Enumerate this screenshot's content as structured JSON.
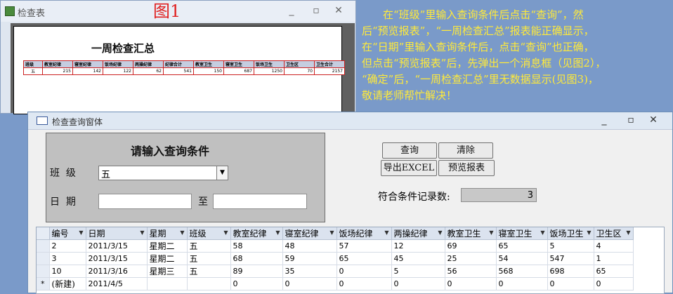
{
  "figure_label": "图1",
  "background_window": {
    "title": "检查表",
    "report_title": "一周检查汇总",
    "headers": [
      "班级",
      "教室纪律",
      "寝室纪律",
      "饭场纪律",
      "两操纪律",
      "纪律合计",
      "教室卫生",
      "寝室卫生",
      "饭场卫生",
      "卫生区",
      "卫生合计"
    ],
    "row": [
      "五",
      "215",
      "142",
      "122",
      "62",
      "541",
      "150",
      "687",
      "1250",
      "70",
      "2157"
    ]
  },
  "instructions": [
    "在“班级”里输入查询条件后点击“查询”，然",
    "后“预览报表”，“一周检查汇总”报表能正确显示，",
    "在“日期”里输入查询条件后，点击“查询”也正确，",
    "但点击“预览报表”后，先弹出一个消息框（见图2），",
    "“确定”后，“一周检查汇总”里无数据显示(见图3)，",
    "敬请老师帮忙解决！"
  ],
  "main_window": {
    "title": "检查查询窗体",
    "criteria": {
      "title": "请输入查询条件",
      "class_label": "班  级",
      "class_value": "五",
      "date_label": "日  期",
      "to_label": "至",
      "date_from": "",
      "date_to": ""
    },
    "buttons": {
      "query": "查询",
      "clear": "清除",
      "export": "导出EXCEL",
      "preview": "预览报表"
    },
    "count_label": "符合条件记录数:",
    "count_value": "3",
    "grid": {
      "columns": [
        "编号",
        "日期",
        "星期",
        "班级",
        "教室纪律",
        "寝室纪律",
        "饭场纪律",
        "两操纪律",
        "教室卫生",
        "寝室卫生",
        "饭场卫生",
        "卫生区"
      ],
      "rows": [
        [
          "2",
          "2011/3/15",
          "星期二",
          "五",
          "58",
          "48",
          "57",
          "12",
          "69",
          "65",
          "5",
          "4"
        ],
        [
          "3",
          "2011/3/15",
          "星期二",
          "五",
          "68",
          "59",
          "65",
          "45",
          "25",
          "54",
          "547",
          "1"
        ],
        [
          "10",
          "2011/3/16",
          "星期三",
          "五",
          "89",
          "35",
          "0",
          "5",
          "56",
          "568",
          "698",
          "65"
        ]
      ],
      "new_row_marker": "*",
      "new_row": [
        "(新建)",
        "2011/4/5",
        "",
        "",
        "0",
        "0",
        "0",
        "0",
        "0",
        "0",
        "0",
        "0"
      ]
    }
  }
}
